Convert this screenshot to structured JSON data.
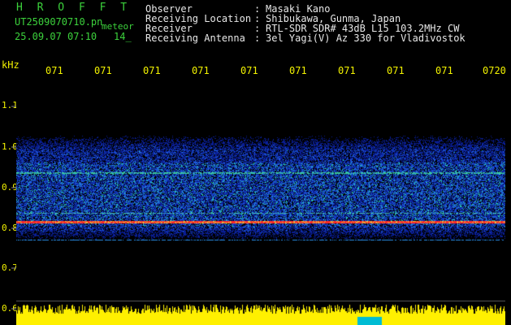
{
  "header": {
    "title": "H R O F F T",
    "filename": "UT2509070710.pn",
    "tag": "meteor",
    "datetime": "25.09.07 07:10",
    "sequence": "14_"
  },
  "info": [
    {
      "label": "Observer",
      "value": "Masaki Kano"
    },
    {
      "label": "Receiving Location",
      "value": "Shibukawa, Gunma, Japan"
    },
    {
      "label": "Receiver",
      "value": "RTL-SDR SDR# 43dB L15 103.2MHz CW"
    },
    {
      "label": "Receiving Antenna",
      "value": "3el Yagi(V) Az 330 for Vladivostok"
    }
  ],
  "separator": ":",
  "axis": {
    "y_unit": "kHz",
    "y_ticks": [
      "1.1",
      "1.0",
      "0.9",
      "0.8",
      "0.7",
      "0.6"
    ],
    "x_ticks": [
      "071",
      "071",
      "071",
      "071",
      "071",
      "071",
      "071",
      "071",
      "071",
      "0720"
    ]
  },
  "colors": {
    "background": "#000000",
    "title": "#3cd23c",
    "text": "#e8e8e8",
    "axis_labels": "#f2f200",
    "noise_low": "#0a1e8c",
    "noise_mid": "#1e5adc",
    "noise_high": "#28c8b4",
    "signal": "#ff2a2a",
    "amplitude": "#ffff00"
  }
}
